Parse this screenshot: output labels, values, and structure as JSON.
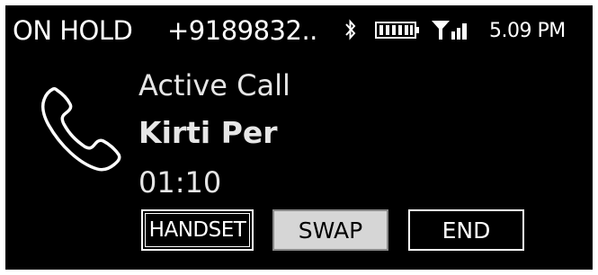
{
  "status_bar": {
    "call_state": "ON HOLD",
    "held_number": "+9189832..",
    "time": "5.09 PM",
    "icons": [
      "bluetooth-icon",
      "battery-icon",
      "signal-strength-icon"
    ]
  },
  "active_call": {
    "status": "Active Call",
    "caller_name": "Kirti Per",
    "duration": "01:10"
  },
  "buttons": {
    "handset": "HANDSET",
    "swap": "SWAP",
    "end": "END"
  },
  "colors": {
    "background": "#000000",
    "text": "#ffffff",
    "swap_button_fill": "#d6d6d6"
  }
}
